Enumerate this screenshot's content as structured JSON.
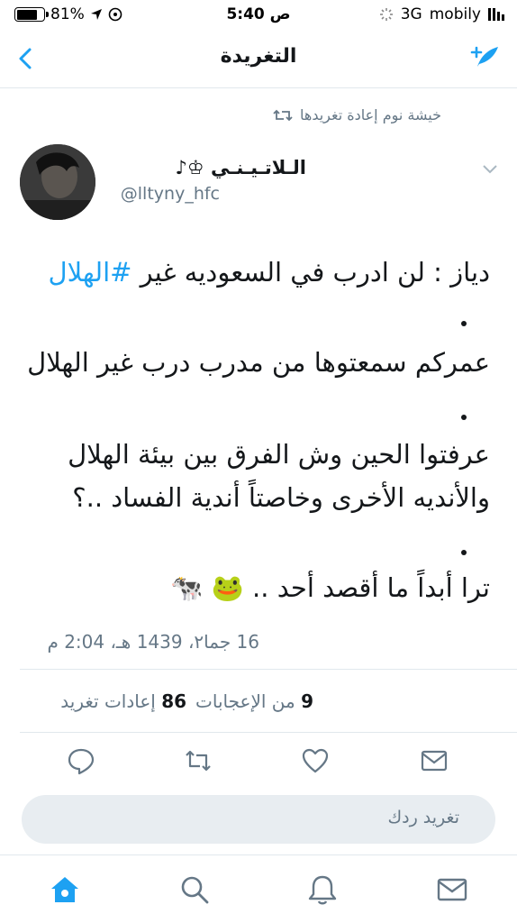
{
  "status_bar": {
    "battery": "81%",
    "time": "5:40 ص",
    "network": "3G",
    "carrier": "mobily"
  },
  "nav": {
    "title": "التغريدة",
    "back_icon": "chevron-left-icon",
    "compose_icon": "compose-tweet-icon"
  },
  "retweet_context": {
    "text": "خيشة نوم إعادة تغريدها"
  },
  "tweet": {
    "author_name": "الـلاتـيـنـي ♔♪",
    "author_handle": "@lltyny_hfc",
    "lines": {
      "l1_text": "دياز : لن ادرب في السعوديه غير ",
      "l1_hashtag": "#الهلال",
      "l2": "عمركم سمعتوها من مدرب درب غير الهلال",
      "l3": "عرفتوا الحين وش الفرق بين بيئة الهلال",
      "l4": "والأنديه الأخرى وخاصتاً أندية الفساد ..؟",
      "l5": "ترا أبداً ما أقصد أحد .. 🐸 🐄"
    },
    "timestamp": "16 جما٢، 1439 هـ، 2:04 م"
  },
  "stats": {
    "retweets": "86",
    "retweets_label": "إعادات تغريد",
    "likes": "9",
    "likes_label": "من الإعجابات"
  },
  "reply_box": {
    "placeholder": "تغريد ردك"
  },
  "colors": {
    "accent": "#1da1f2",
    "secondary_text": "#657786",
    "divider": "#e1e8ed"
  }
}
